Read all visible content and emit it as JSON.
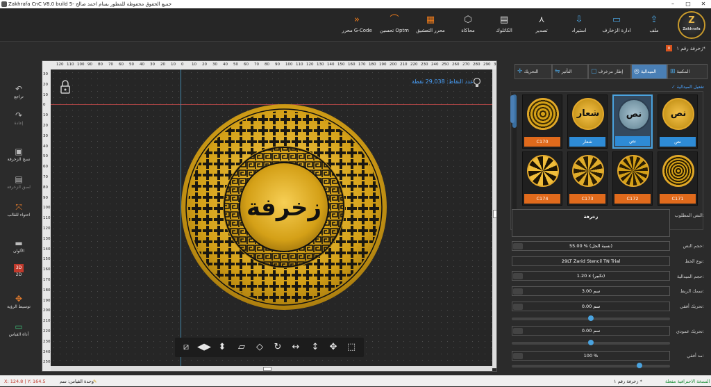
{
  "titlebar": {
    "title": "Zakhrafa CnC V8.0 build 5- جميع الحقوق محفوظة للمطور بسام احمد صالح"
  },
  "ribbon": {
    "logo_letter": "Z",
    "logo_sub": "Zakhrafa",
    "items": [
      {
        "label": "ملف",
        "icon": "export-icon"
      },
      {
        "label": "ادارة الزخارف",
        "icon": "folder-icon"
      },
      {
        "label": "استيراد",
        "icon": "import-icon"
      },
      {
        "label": "تصدير",
        "icon": "share-icon"
      },
      {
        "label": "الكاتلوك",
        "icon": "catalog-icon"
      },
      {
        "label": "محاكاة",
        "icon": "cube-icon"
      },
      {
        "label": "محرر التعشيق",
        "icon": "editor-icon"
      },
      {
        "label": "تحسين Optm",
        "icon": "curve-icon"
      },
      {
        "label": "محرر G-Code",
        "icon": "fast-forward-icon"
      }
    ]
  },
  "document_tab": {
    "label": "زخرفة رقم ١*"
  },
  "left_toolbar": [
    {
      "label": "تراجع",
      "icon": "undo-icon"
    },
    {
      "label": "إعادة",
      "icon": "redo-icon"
    },
    {
      "label": "نسخ الزخرفة",
      "icon": "copy-icon"
    },
    {
      "label": "لصق الزخرفة",
      "icon": "paste-icon"
    },
    {
      "label": "احتواء للقالب",
      "icon": "fit-icon"
    },
    {
      "label": "الألوان",
      "icon": "colors-icon"
    },
    {
      "label": "2D",
      "icon": "3d-toggle-icon",
      "badge": "3D"
    },
    {
      "label": "توسيط الرؤية",
      "icon": "center-view-icon"
    },
    {
      "label": "أداة القياس",
      "icon": "ruler-icon"
    }
  ],
  "canvas": {
    "points_label": "عدد النقاط: 29,038 نقطة",
    "ruler_top": [
      "120",
      "110",
      "100",
      "90",
      "80",
      "70",
      "60",
      "50",
      "40",
      "30",
      "20",
      "10",
      "0",
      "10",
      "20",
      "30",
      "40",
      "50",
      "60",
      "70",
      "80",
      "90",
      "100",
      "110",
      "120",
      "130",
      "140",
      "150",
      "160",
      "170",
      "180",
      "190",
      "200",
      "210",
      "220",
      "230",
      "240",
      "250",
      "260",
      "270",
      "280",
      "290",
      "300"
    ],
    "ruler_left": [
      "30",
      "20",
      "10",
      "0",
      "10",
      "20",
      "30",
      "40",
      "50",
      "60",
      "70",
      "80",
      "90",
      "100",
      "110",
      "120",
      "130",
      "140",
      "150",
      "160",
      "170",
      "180",
      "190",
      "200",
      "210",
      "220",
      "230",
      "240",
      "250"
    ],
    "center_text": "زخرفة",
    "colors": {
      "gold": "#d4a017",
      "gold_dark": "#a67c0e",
      "ink": "#111111"
    }
  },
  "canvas_tools": [
    {
      "icon": "slash-edit-icon"
    },
    {
      "icon": "flip-horizontal-icon"
    },
    {
      "icon": "flip-vertical-icon"
    },
    {
      "icon": "skew-icon"
    },
    {
      "icon": "distort-icon"
    },
    {
      "icon": "rotate-icon"
    },
    {
      "icon": "stretch-horizontal-icon"
    },
    {
      "icon": "stretch-vertical-icon"
    },
    {
      "icon": "move-all-icon"
    },
    {
      "icon": "resize-icon"
    }
  ],
  "right_panel": {
    "tabs": [
      {
        "label": "المكتبة",
        "icon": "library-icon"
      },
      {
        "label": "الميدالية",
        "icon": "medal-icon",
        "active": true
      },
      {
        "label": "إطار مزخرف",
        "icon": "frame-icon"
      },
      {
        "label": "التأثير",
        "icon": "effect-icon"
      },
      {
        "label": "التحريك",
        "icon": "move-icon"
      }
    ],
    "enable_medal": "تفعيل الميدالية",
    "gallery": [
      {
        "label": "نص",
        "style": "blue",
        "thumb": "نص"
      },
      {
        "label": "نص",
        "style": "blue",
        "thumb": "نص",
        "selected": true
      },
      {
        "label": "شعار",
        "style": "blue",
        "thumb": "شعار"
      },
      {
        "label": "C170",
        "style": "orange",
        "thumb": ""
      },
      {
        "label": "C171",
        "style": "orange",
        "thumb": ""
      },
      {
        "label": "C172",
        "style": "orange",
        "thumb": ""
      },
      {
        "label": "C173",
        "style": "orange",
        "thumb": ""
      },
      {
        "label": "C174",
        "style": "orange",
        "thumb": ""
      }
    ],
    "fields": {
      "text_label": "النص المطلوب:",
      "text_value": "زخرفة",
      "text_size_label": "حجم النص:",
      "text_size_value": "55.00 % (نسبة الحل)",
      "font_label": "نوع الخط:",
      "font_value": "29LT Zarid Stencil TN Trial",
      "medal_size_label": "حجم الميدالية:",
      "medal_size_value": "1.20 x (تكبير)",
      "link_thick_label": "سمك الربط:",
      "link_thick_value": "3.00 سم",
      "hmove_label": "تحريك أفقي:",
      "hmove_value": "0.00 سم",
      "vmove_label": "تحريك عمودي:",
      "vmove_value": "0.00 سم",
      "hstretch_label": "مد أفقي:",
      "hstretch_value": "100 %"
    }
  },
  "status": {
    "coords": "X: 124.8 | Y: 164.5",
    "unit": "وحدة القياس: سم",
    "doc": "زخرفة رقم ١ *",
    "backup": "النسخة الاحترافية مفعلة ✓"
  }
}
